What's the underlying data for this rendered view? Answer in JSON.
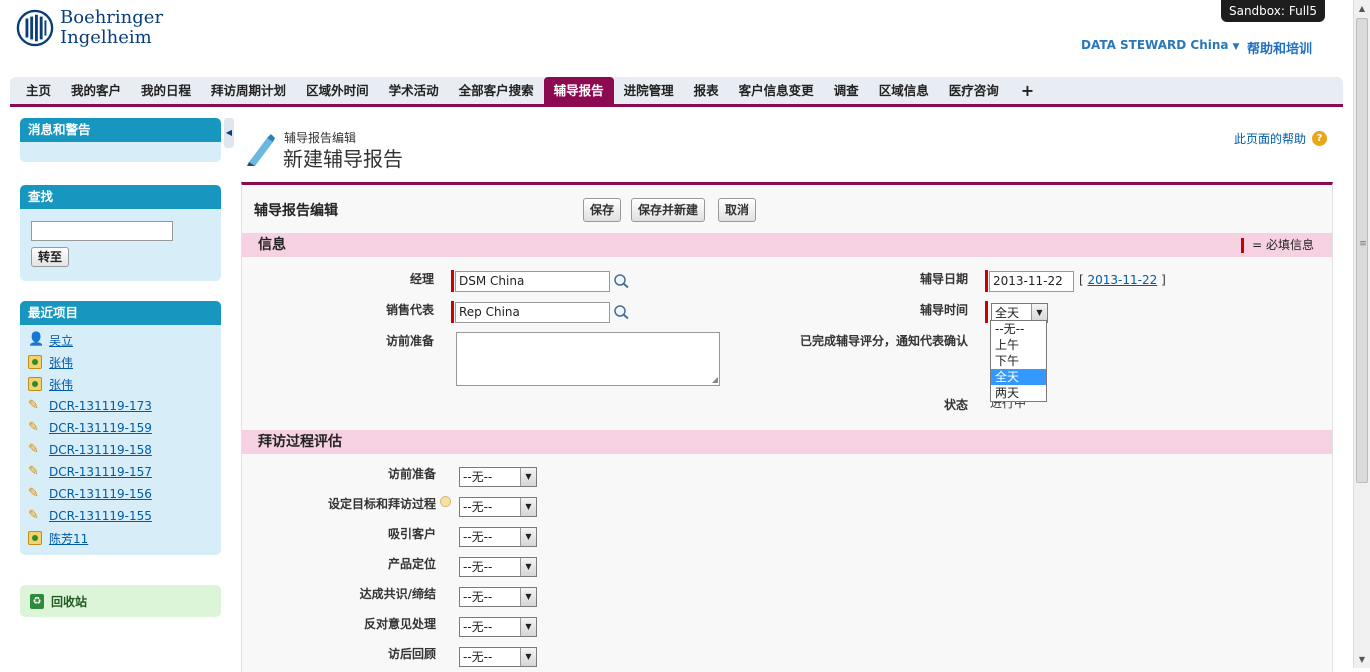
{
  "brand": {
    "line1": "Boehringer",
    "line2": "Ingelheim"
  },
  "sandbox": {
    "label": "Sandbox:",
    "org": "Full5"
  },
  "user_menu": {
    "label": "DATA STEWARD China"
  },
  "help_training": "帮助和培训",
  "tabs": [
    {
      "label": "主页"
    },
    {
      "label": "我的客户"
    },
    {
      "label": "我的日程"
    },
    {
      "label": "拜访周期计划"
    },
    {
      "label": "区域外时间"
    },
    {
      "label": "学术活动"
    },
    {
      "label": "全部客户搜索"
    },
    {
      "label": "辅导报告",
      "active": true
    },
    {
      "label": "进院管理"
    },
    {
      "label": "报表"
    },
    {
      "label": "客户信息变更"
    },
    {
      "label": "调查"
    },
    {
      "label": "区域信息"
    },
    {
      "label": "医疗咨询"
    },
    {
      "label": "+"
    }
  ],
  "sidebar": {
    "messages_title": "消息和警告",
    "find_title": "查找",
    "find_input": "",
    "goto_label": "转至",
    "recent_title": "最近项目",
    "recent_items": [
      {
        "icon": "person-icon",
        "label": "吴立"
      },
      {
        "icon": "contact-icon",
        "label": "张伟"
      },
      {
        "icon": "contact-icon",
        "label": "张伟"
      },
      {
        "icon": "pencil-icon",
        "label": "DCR-131119-173"
      },
      {
        "icon": "pencil-icon",
        "label": "DCR-131119-159"
      },
      {
        "icon": "pencil-icon",
        "label": "DCR-131119-158"
      },
      {
        "icon": "pencil-icon",
        "label": "DCR-131119-157"
      },
      {
        "icon": "pencil-icon",
        "label": "DCR-131119-156"
      },
      {
        "icon": "pencil-icon",
        "label": "DCR-131119-155"
      },
      {
        "icon": "contact-icon",
        "label": "陈芳11"
      }
    ],
    "recycle_label": "回收站"
  },
  "page": {
    "type": "辅导报告编辑",
    "title": "新建辅导报告",
    "help_link": "此页面的帮助"
  },
  "form": {
    "block_title": "辅导报告编辑",
    "buttons": {
      "save": "保存",
      "save_new": "保存并新建",
      "cancel": "取消"
    },
    "info_section": "信息",
    "required_note": "= 必填信息",
    "manager_label": "经理",
    "manager_value": "DSM China",
    "rep_label": "销售代表",
    "rep_value": "Rep China",
    "prep_label": "访前准备",
    "date_label": "辅导日期",
    "date_value": "2013-11-22",
    "date_link": "2013-11-22",
    "time_label": "辅导时间",
    "time_value": "全天",
    "time_options": [
      "--无--",
      "上午",
      "下午",
      "全天",
      "两天"
    ],
    "confirm_label": "已完成辅导评分，通知代表确认",
    "status_label": "状态",
    "status_value": "进行中",
    "eval_section": "拜访过程评估",
    "eval_rows": [
      {
        "label": "访前准备",
        "value": "--无--"
      },
      {
        "label": "设定目标和拜访过程",
        "value": "--无--"
      },
      {
        "label": "吸引客户",
        "value": "--无--"
      },
      {
        "label": "产品定位",
        "value": "--无--"
      },
      {
        "label": "达成共识/缔结",
        "value": "--无--"
      },
      {
        "label": "反对意见处理",
        "value": "--无--"
      },
      {
        "label": "访后回顾",
        "value": "--无--"
      }
    ]
  },
  "colors": {
    "accent": "#8b0a50",
    "sidebar_head": "#1797c0",
    "section_bg": "#f5d1e2",
    "required": "#cc0000"
  }
}
